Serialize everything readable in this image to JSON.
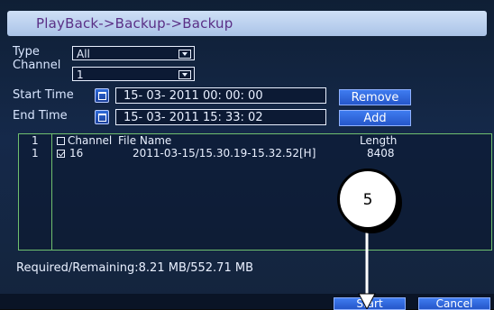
{
  "title": "PlayBack->Backup->Backup",
  "form": {
    "type_label": "Type",
    "type_value": "All",
    "channel_label": "Channel",
    "channel_value": "1",
    "start_time_label": "Start Time",
    "start_time_value": "15- 03- 2011   00: 00: 00",
    "end_time_label": "End Time",
    "end_time_value": "15- 03- 2011   15: 33: 02"
  },
  "buttons": {
    "remove": "Remove",
    "add": "Add",
    "start": "Start",
    "cancel": "Cancel"
  },
  "table": {
    "headers": {
      "index": "1",
      "channel": "Channel",
      "file_name": "File Name",
      "length": "Length"
    },
    "rows": [
      {
        "index": "1",
        "channel": "16",
        "file_name": "2011-03-15/15.30.19-15.32.52[H]",
        "length": "8408"
      }
    ]
  },
  "status": "Required/Remaining:8.21 MB/552.71 MB",
  "callout": {
    "label": "5"
  },
  "colors": {
    "panel": "#15294a",
    "title_text": "#5a2f86",
    "accent_button": "#2f66e0",
    "list_border": "#6fbf6f"
  }
}
